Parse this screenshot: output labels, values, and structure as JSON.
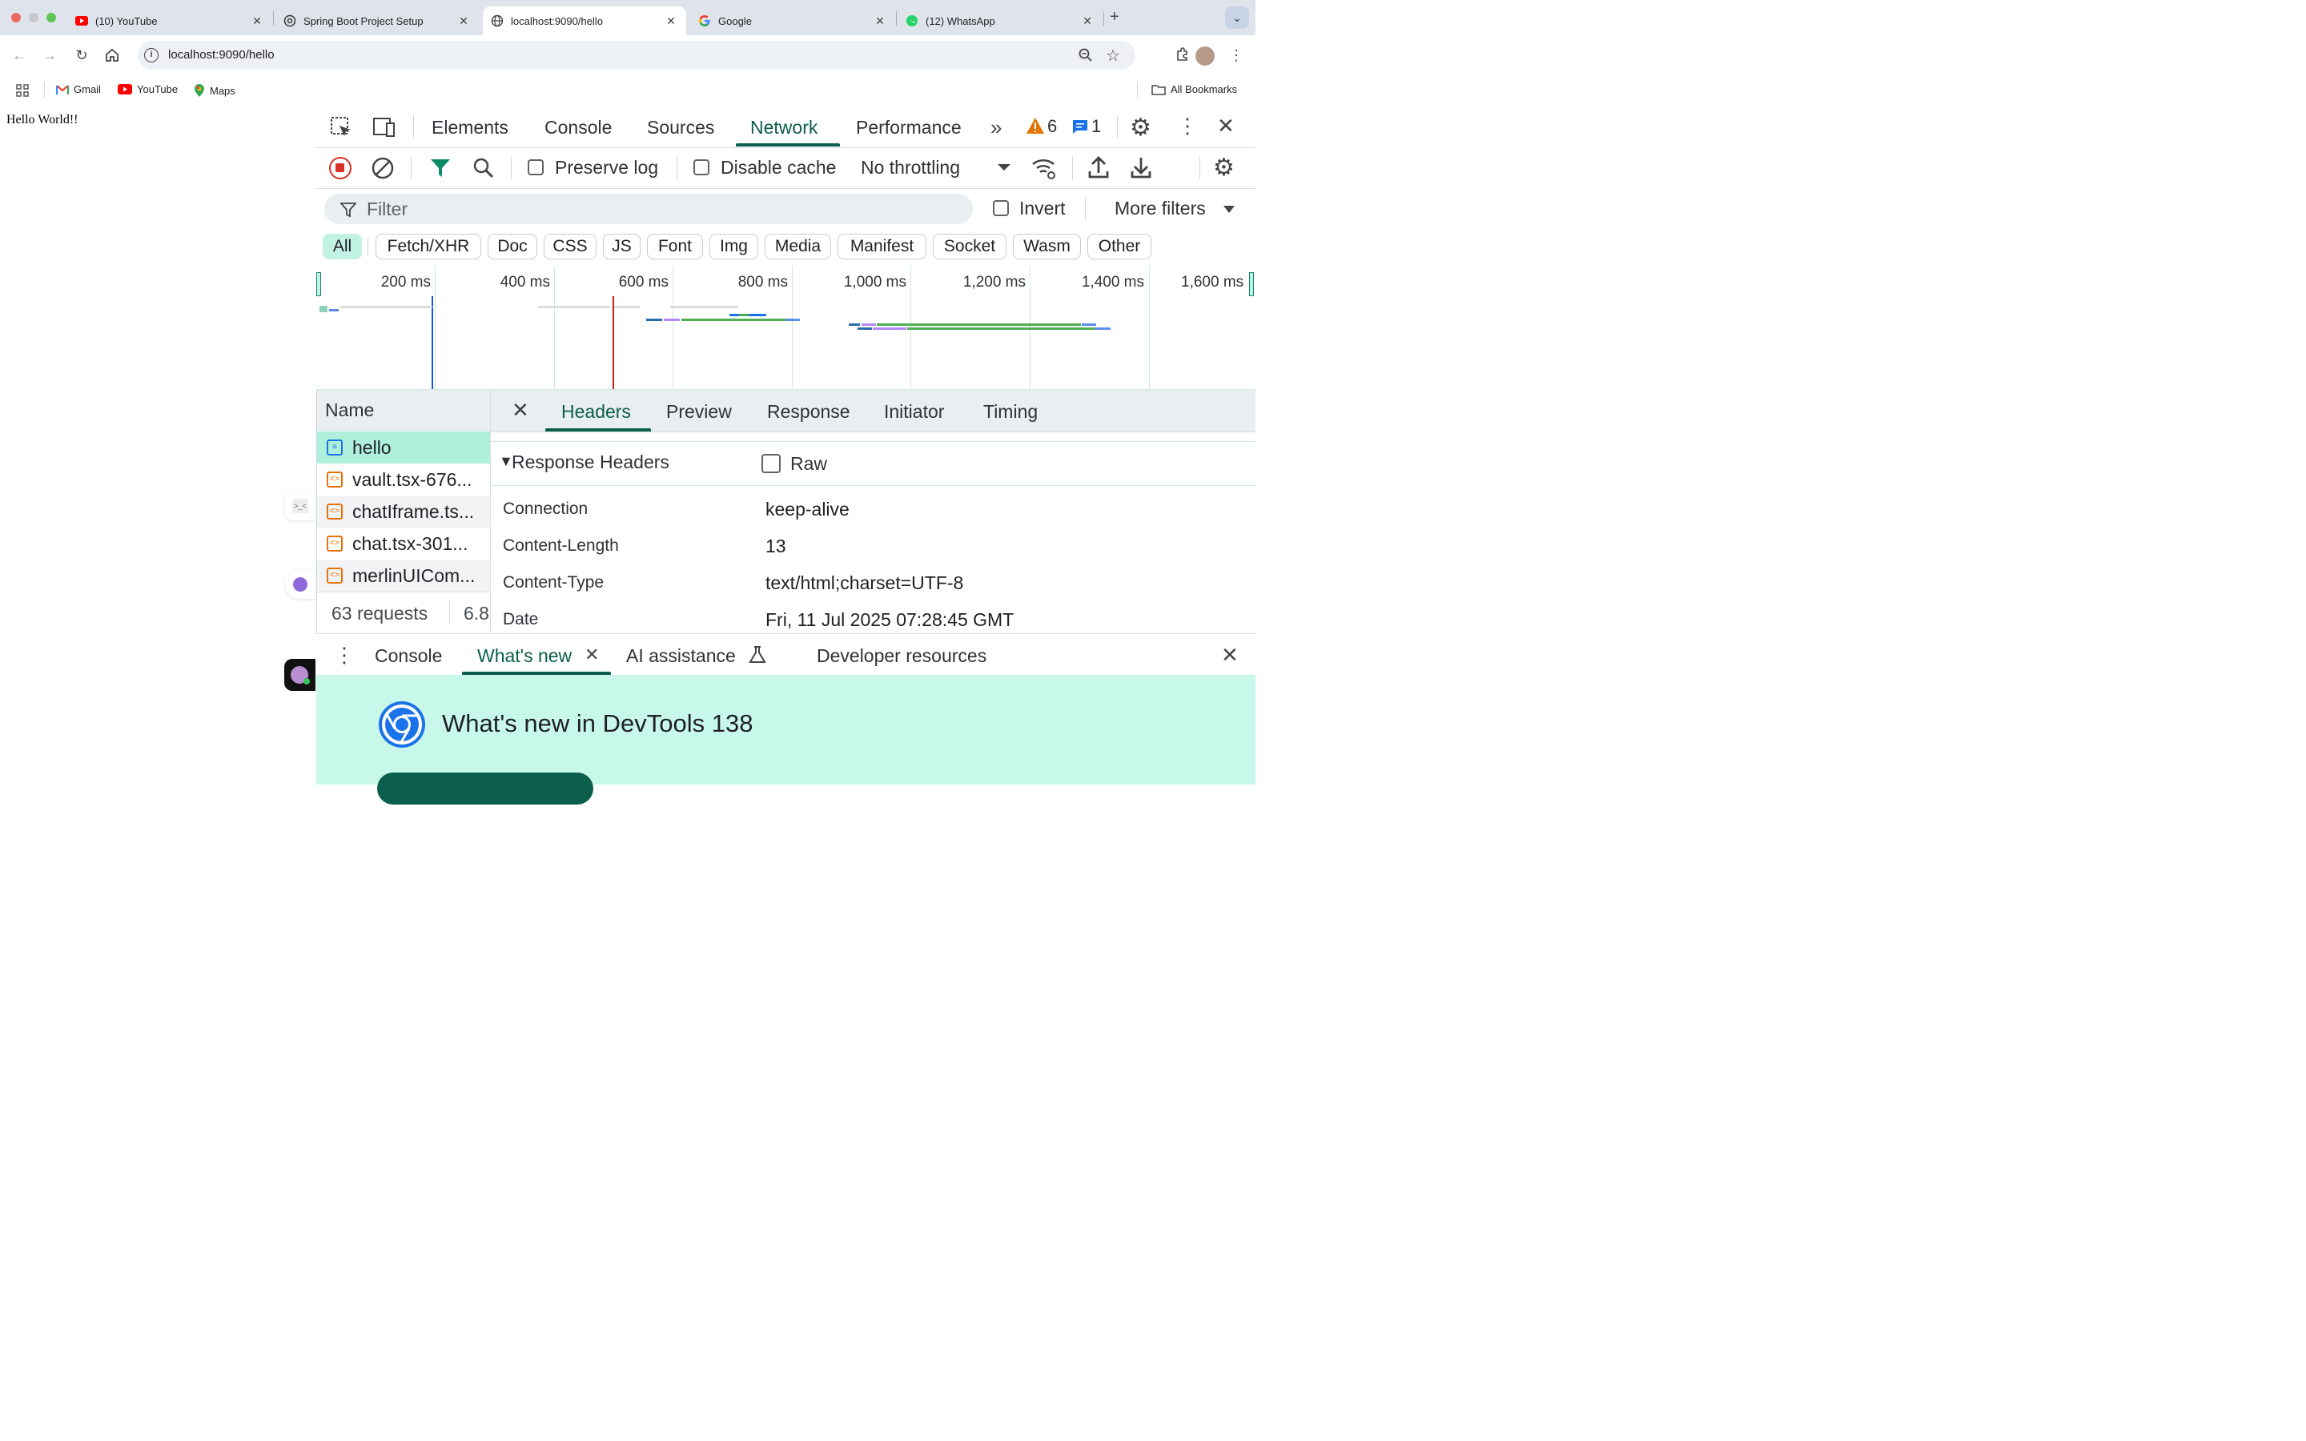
{
  "tabs": [
    {
      "title": "(10) YouTube",
      "icon": "youtube-icon",
      "active": false
    },
    {
      "title": "Spring Boot Project Setup",
      "icon": "openai-icon",
      "active": false
    },
    {
      "title": "localhost:9090/hello",
      "icon": "globe-icon",
      "active": true
    },
    {
      "title": "Google",
      "icon": "google-icon",
      "active": false
    },
    {
      "title": "(12) WhatsApp",
      "icon": "whatsapp-icon",
      "active": false
    }
  ],
  "new_tab": "+",
  "address": {
    "url": "localhost:9090/hello"
  },
  "bookmarks": [
    {
      "label": "Gmail",
      "icon": "gmail-icon"
    },
    {
      "label": "YouTube",
      "icon": "youtube-icon"
    },
    {
      "label": "Maps",
      "icon": "maps-icon"
    }
  ],
  "all_bookmarks": "All Bookmarks",
  "page": {
    "text": "Hello World!!"
  },
  "devtools": {
    "main_tabs": [
      "Elements",
      "Console",
      "Sources",
      "Network",
      "Performance"
    ],
    "active_tab": "Network",
    "warnings_count": "6",
    "messages_count": "1",
    "network": {
      "preserve_log": "Preserve log",
      "disable_cache": "Disable cache",
      "throttling": "No throttling",
      "filter_placeholder": "Filter",
      "invert": "Invert",
      "more_filters": "More filters",
      "type_filters": [
        "All",
        "Fetch/XHR",
        "Doc",
        "CSS",
        "JS",
        "Font",
        "Img",
        "Media",
        "Manifest",
        "Socket",
        "Wasm",
        "Other"
      ],
      "active_filter": "All",
      "timeline_ticks": [
        "200 ms",
        "400 ms",
        "600 ms",
        "800 ms",
        "1,000 ms",
        "1,200 ms",
        "1,400 ms",
        "1,600 ms"
      ],
      "name_header": "Name",
      "requests": [
        {
          "name": "hello",
          "type": "doc",
          "selected": true
        },
        {
          "name": "vault.tsx-676...",
          "type": "script",
          "selected": false
        },
        {
          "name": "chatIframe.ts...",
          "type": "script",
          "selected": false
        },
        {
          "name": "chat.tsx-301...",
          "type": "script",
          "selected": false
        },
        {
          "name": "merlinUICom...",
          "type": "script",
          "selected": false
        }
      ],
      "summary_requests": "63 requests",
      "summary_size": "6.8",
      "detail_tabs": [
        "Headers",
        "Preview",
        "Response",
        "Initiator",
        "Timing"
      ],
      "active_detail_tab": "Headers",
      "response_headers_title": "Response Headers",
      "raw_label": "Raw",
      "headers": [
        {
          "name": "Connection",
          "value": "keep-alive"
        },
        {
          "name": "Content-Length",
          "value": "13"
        },
        {
          "name": "Content-Type",
          "value": "text/html;charset=UTF-8"
        },
        {
          "name": "Date",
          "value": "Fri, 11 Jul 2025 07:28:45 GMT"
        }
      ]
    },
    "drawer": {
      "tabs": [
        "Console",
        "What's new",
        "AI assistance",
        "Developer resources"
      ],
      "active_tab": "What's new",
      "whats_new_title": "What's new in DevTools 138"
    }
  },
  "colors": {
    "accent": "#0b5e4b",
    "chip_active": "#c2f2e4",
    "selected_row": "#aef0dc",
    "whats_new_bg": "#c7f8ea",
    "record_red": "#d93025"
  }
}
